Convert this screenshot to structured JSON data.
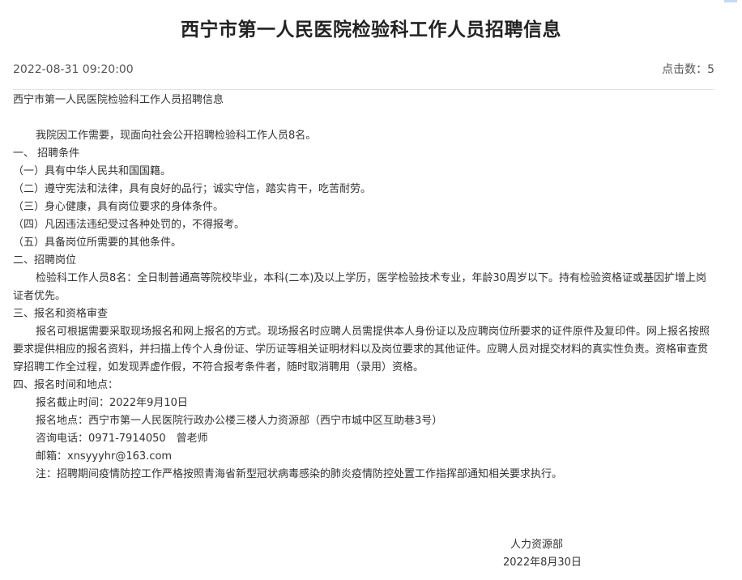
{
  "article": {
    "title": "西宁市第一人民医院检验科工作人员招聘信息",
    "date": "2022-08-31 09:20:00",
    "clicks": "点击数：5"
  },
  "content": {
    "heading": "西宁市第一人民医院检验科工作人员招聘信息",
    "intro": "我院因工作需要，现面向社会公开招聘检验科工作人员8名。",
    "section1_title": "一、 招聘条件",
    "conditions": [
      "（一）具有中华人民共和国国籍。",
      "（二）遵守宪法和法律，具有良好的品行；诚实守信，踏实肯干，吃苦耐劳。",
      "（三）身心健康，具有岗位要求的身体条件。",
      "（四）凡因违法违纪受过各种处罚的，不得报考。",
      "（五）具备岗位所需要的其他条件。"
    ],
    "section2_title": "二、招聘岗位",
    "position": "检验科工作人员8名：全日制普通高等院校毕业，本科(二本)及以上学历，医学检验技术专业，年龄30周岁以下。持有检验资格证或基因扩增上岗证者优先。",
    "section3_title": "三、报名和资格审查",
    "registration": "报名可根据需要采取现场报名和网上报名的方式。现场报名时应聘人员需提供本人身份证以及应聘岗位所要求的证件原件及复印件。网上报名按照要求提供相应的报名资料，并扫描上传个人身份证、学历证等相关证明材料以及岗位要求的其他证件。应聘人员对提交材料的真实性负责。资格审查贯穿招聘工作全过程，如发现弄虚作假，不符合报考条件者，随时取消聘用（录用）资格。",
    "section4_title": "四、报名时间和地点：",
    "deadline": "报名截止时间：2022年9月10日",
    "location": "报名地点：西宁市第一人民医院行政办公楼三楼人力资源部（西宁市城中区互助巷3号）",
    "phone": "咨询电话：0971-7914050　曾老师",
    "email": "邮箱：xnsyyyhr@163.com",
    "note": "注：招聘期间疫情防控工作严格按照青海省新型冠状病毒感染的肺炎疫情防控处置工作指挥部通知相关要求执行。"
  },
  "signature": {
    "department": "人力资源部",
    "date": "2022年8月30日"
  }
}
